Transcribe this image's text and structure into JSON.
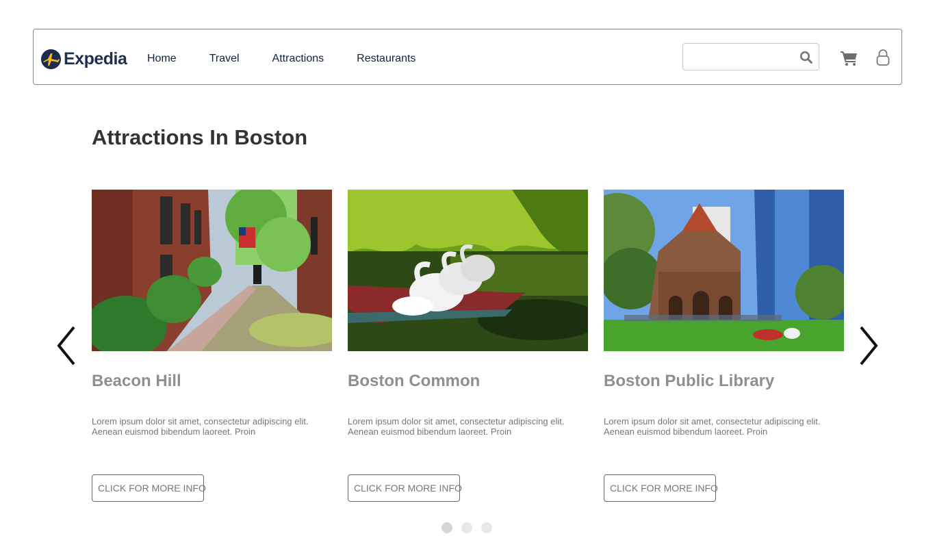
{
  "header": {
    "logo_text": "Expedia",
    "nav": [
      {
        "label": "Home"
      },
      {
        "label": "Travel"
      },
      {
        "label": "Attractions"
      },
      {
        "label": "Restaurants"
      }
    ],
    "search": {
      "value": "",
      "placeholder": ""
    },
    "icons": [
      "search-icon",
      "cart-icon",
      "user-icon"
    ]
  },
  "main": {
    "title": "Attractions In Boston",
    "cards": [
      {
        "name": "Beacon Hill",
        "description": "Lorem ipsum dolor sit amet, consectetur adipiscing elit. Aenean euismod bibendum laoreet. Proin",
        "button": "CLICK FOR MORE INFO"
      },
      {
        "name": "Boston Common",
        "description": "Lorem ipsum dolor sit amet, consectetur adipiscing elit. Aenean euismod bibendum laoreet. Proin",
        "button": "CLICK FOR MORE INFO"
      },
      {
        "name": "Boston Public Library",
        "description": "Lorem ipsum dolor sit amet, consectetur adipiscing elit. Aenean euismod bibendum laoreet. Proin",
        "button": "CLICK FOR MORE INFO"
      }
    ],
    "carousel": {
      "pages": 3,
      "active_page": 1
    }
  },
  "colors": {
    "brand_navy": "#1f2f4f",
    "nav_text": "#10223f",
    "title_text": "#333333",
    "card_name": "#8f8f8f",
    "body_text": "#777777",
    "border": "#8a8a8a"
  }
}
